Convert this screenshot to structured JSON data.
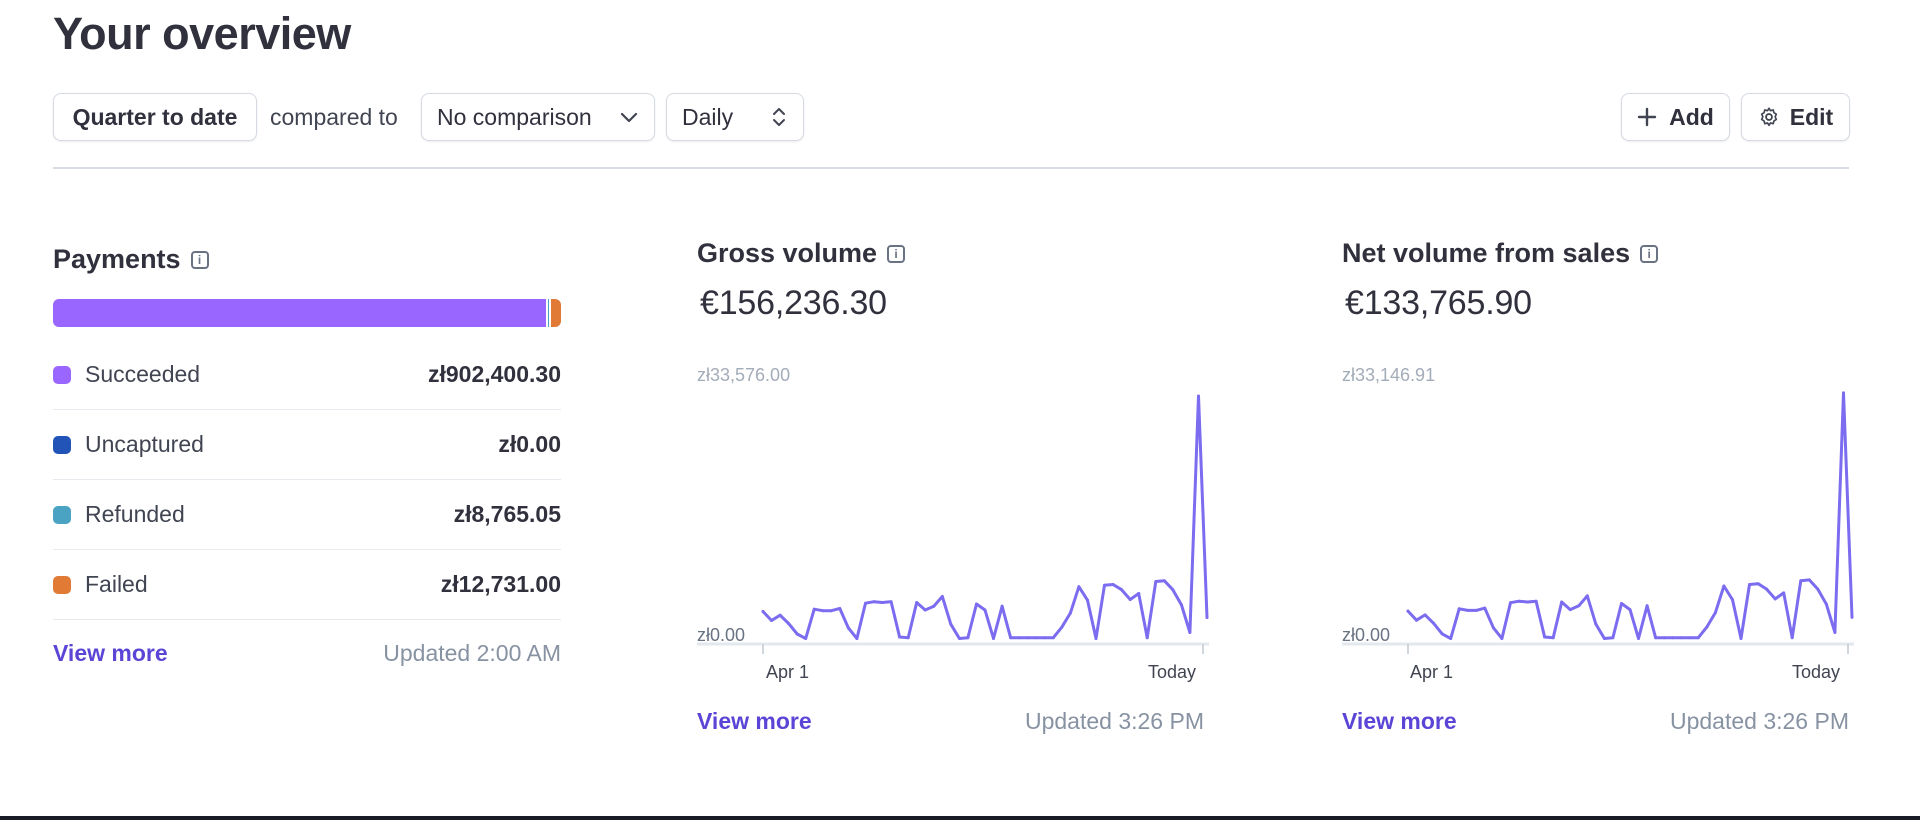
{
  "page": {
    "title": "Your overview"
  },
  "toolbar": {
    "range_label": "Quarter to date",
    "compared_to": "compared to",
    "comparison_label": "No comparison",
    "interval_label": "Daily",
    "add_label": "Add",
    "edit_label": "Edit"
  },
  "colors": {
    "accent": "#5b45d6",
    "succeeded": "#9966ff",
    "uncaptured": "#2254b8",
    "refunded": "#4aa3c2",
    "failed": "#e07a35",
    "line": "#7b6cf0"
  },
  "payments": {
    "title": "Payments",
    "info_icon": "info-icon",
    "rows": [
      {
        "label": "Succeeded",
        "value": "zł902,400.30",
        "color_key": "succeeded",
        "share": 0.9775
      },
      {
        "label": "Uncaptured",
        "value": "zł0.00",
        "color_key": "uncaptured",
        "share": 0.0
      },
      {
        "label": "Refunded",
        "value": "zł8,765.05",
        "color_key": "refunded",
        "share": 0.003
      },
      {
        "label": "Failed",
        "value": "zł12,731.00",
        "color_key": "failed",
        "share": 0.0195
      }
    ],
    "view_more": "View more",
    "updated": "Updated 2:00 AM"
  },
  "gross": {
    "title": "Gross volume",
    "value": "€156,236.30",
    "y_max_label": "zł33,576.00",
    "y_min_label": "zł0.00",
    "x_start_label": "Apr 1",
    "x_end_label": "Today",
    "view_more": "View more",
    "updated": "Updated 3:26 PM"
  },
  "net": {
    "title": "Net volume from sales",
    "value": "€133,765.90",
    "y_max_label": "zł33,146.91",
    "y_min_label": "zł0.00",
    "x_start_label": "Apr 1",
    "x_end_label": "Today",
    "view_more": "View more",
    "updated": "Updated 3:26 PM"
  },
  "chart_data": [
    {
      "type": "line",
      "title": "Gross volume",
      "x_labels": [
        "Apr 1",
        "Today"
      ],
      "ylim": [
        0,
        33576.0
      ],
      "values": [
        3800,
        2600,
        3300,
        2200,
        800,
        200,
        4100,
        3900,
        3900,
        4200,
        1600,
        200,
        4900,
        5100,
        5000,
        5100,
        400,
        300,
        5000,
        4000,
        4500,
        5800,
        2100,
        200,
        300,
        4800,
        4000,
        200,
        4500,
        300,
        300,
        300,
        300,
        300,
        300,
        1700,
        3600,
        7100,
        5300,
        200,
        7300,
        7400,
        6700,
        5400,
        6200,
        300,
        7800,
        7900,
        6700,
        4700,
        1000,
        32500,
        3000
      ]
    },
    {
      "type": "line",
      "title": "Net volume from sales",
      "x_labels": [
        "Apr 1",
        "Today"
      ],
      "ylim": [
        0,
        33146.91
      ],
      "values": [
        3800,
        2600,
        3300,
        2200,
        800,
        200,
        4100,
        3900,
        3900,
        4200,
        1600,
        200,
        4900,
        5100,
        5000,
        5100,
        400,
        300,
        5000,
        4000,
        4500,
        5800,
        2100,
        200,
        300,
        4800,
        4000,
        200,
        4500,
        300,
        300,
        300,
        300,
        300,
        300,
        1700,
        3600,
        7100,
        5300,
        200,
        7300,
        7400,
        6700,
        5400,
        6200,
        300,
        7800,
        7900,
        6700,
        4700,
        1000,
        32500,
        3000
      ]
    }
  ]
}
